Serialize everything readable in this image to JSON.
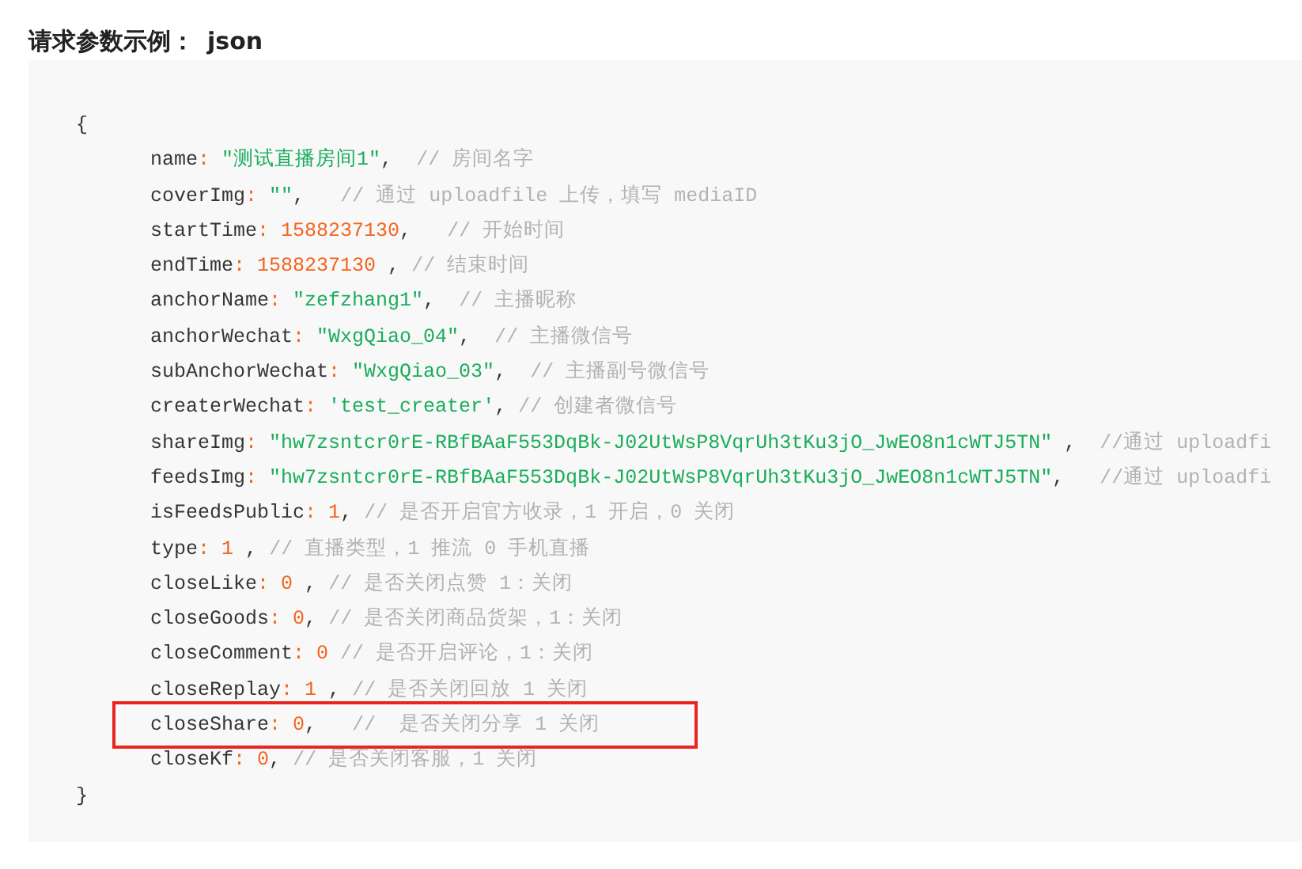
{
  "heading": {
    "label": "请求参数示例：",
    "format": "json"
  },
  "code_block": {
    "lines": [
      {
        "kind": "brace",
        "highlighted": false,
        "tokens": [
          {
            "kind": "plain",
            "text": "{"
          }
        ]
      },
      {
        "kind": "field",
        "highlighted": false,
        "tokens": [
          {
            "kind": "key",
            "text": "name"
          },
          {
            "kind": "colon",
            "text": ": "
          },
          {
            "kind": "string",
            "text": "\"测试直播房间1\""
          },
          {
            "kind": "plain",
            "text": ",  "
          },
          {
            "kind": "comment",
            "text": "// 房间名字"
          }
        ]
      },
      {
        "kind": "field",
        "highlighted": false,
        "tokens": [
          {
            "kind": "key",
            "text": "coverImg"
          },
          {
            "kind": "colon",
            "text": ": "
          },
          {
            "kind": "string",
            "text": "\"\""
          },
          {
            "kind": "plain",
            "text": ",   "
          },
          {
            "kind": "comment",
            "text": "// 通过 uploadfile 上传，填写 mediaID"
          }
        ]
      },
      {
        "kind": "field",
        "highlighted": false,
        "tokens": [
          {
            "kind": "key",
            "text": "startTime"
          },
          {
            "kind": "colon",
            "text": ": "
          },
          {
            "kind": "number",
            "text": "1588237130"
          },
          {
            "kind": "plain",
            "text": ",   "
          },
          {
            "kind": "comment",
            "text": "// 开始时间"
          }
        ]
      },
      {
        "kind": "field",
        "highlighted": false,
        "tokens": [
          {
            "kind": "key",
            "text": "endTime"
          },
          {
            "kind": "colon",
            "text": ": "
          },
          {
            "kind": "number",
            "text": "1588237130"
          },
          {
            "kind": "plain",
            "text": " , "
          },
          {
            "kind": "comment",
            "text": "// 结束时间"
          }
        ]
      },
      {
        "kind": "field",
        "highlighted": false,
        "tokens": [
          {
            "kind": "key",
            "text": "anchorName"
          },
          {
            "kind": "colon",
            "text": ": "
          },
          {
            "kind": "string",
            "text": "\"zefzhang1\""
          },
          {
            "kind": "plain",
            "text": ",  "
          },
          {
            "kind": "comment",
            "text": "// 主播昵称"
          }
        ]
      },
      {
        "kind": "field",
        "highlighted": false,
        "tokens": [
          {
            "kind": "key",
            "text": "anchorWechat"
          },
          {
            "kind": "colon",
            "text": ": "
          },
          {
            "kind": "string",
            "text": "\"WxgQiao_04\""
          },
          {
            "kind": "plain",
            "text": ",  "
          },
          {
            "kind": "comment",
            "text": "// 主播微信号"
          }
        ]
      },
      {
        "kind": "field",
        "highlighted": false,
        "tokens": [
          {
            "kind": "key",
            "text": "subAnchorWechat"
          },
          {
            "kind": "colon",
            "text": ": "
          },
          {
            "kind": "string",
            "text": "\"WxgQiao_03\""
          },
          {
            "kind": "plain",
            "text": ",  "
          },
          {
            "kind": "comment",
            "text": "// 主播副号微信号"
          }
        ]
      },
      {
        "kind": "field",
        "highlighted": false,
        "tokens": [
          {
            "kind": "key",
            "text": "createrWechat"
          },
          {
            "kind": "colon",
            "text": ": "
          },
          {
            "kind": "string",
            "text": "'test_creater'"
          },
          {
            "kind": "plain",
            "text": ", "
          },
          {
            "kind": "comment",
            "text": "// 创建者微信号"
          }
        ]
      },
      {
        "kind": "field",
        "highlighted": false,
        "tokens": [
          {
            "kind": "key",
            "text": "shareImg"
          },
          {
            "kind": "colon",
            "text": ": "
          },
          {
            "kind": "string",
            "text": "\"hw7zsntcr0rE-RBfBAaF553DqBk-J02UtWsP8VqrUh3tKu3jO_JwEO8n1cWTJ5TN\""
          },
          {
            "kind": "plain",
            "text": " ,  "
          },
          {
            "kind": "comment",
            "text": "//通过 uploadfi"
          }
        ]
      },
      {
        "kind": "field",
        "highlighted": false,
        "tokens": [
          {
            "kind": "key",
            "text": "feedsImg"
          },
          {
            "kind": "colon",
            "text": ": "
          },
          {
            "kind": "string",
            "text": "\"hw7zsntcr0rE-RBfBAaF553DqBk-J02UtWsP8VqrUh3tKu3jO_JwEO8n1cWTJ5TN\""
          },
          {
            "kind": "plain",
            "text": ",   "
          },
          {
            "kind": "comment",
            "text": "//通过 uploadfi"
          }
        ]
      },
      {
        "kind": "field",
        "highlighted": false,
        "tokens": [
          {
            "kind": "key",
            "text": "isFeedsPublic"
          },
          {
            "kind": "colon",
            "text": ": "
          },
          {
            "kind": "number",
            "text": "1"
          },
          {
            "kind": "plain",
            "text": ", "
          },
          {
            "kind": "comment",
            "text": "// 是否开启官方收录，1 开启，0 关闭"
          }
        ]
      },
      {
        "kind": "field",
        "highlighted": false,
        "tokens": [
          {
            "kind": "key",
            "text": "type"
          },
          {
            "kind": "colon",
            "text": ": "
          },
          {
            "kind": "number",
            "text": "1"
          },
          {
            "kind": "plain",
            "text": " , "
          },
          {
            "kind": "comment",
            "text": "// 直播类型，1 推流 0 手机直播"
          }
        ]
      },
      {
        "kind": "field",
        "highlighted": false,
        "tokens": [
          {
            "kind": "key",
            "text": "closeLike"
          },
          {
            "kind": "colon",
            "text": ": "
          },
          {
            "kind": "number",
            "text": "0"
          },
          {
            "kind": "plain",
            "text": " , "
          },
          {
            "kind": "comment",
            "text": "// 是否关闭点赞 1：关闭"
          }
        ]
      },
      {
        "kind": "field",
        "highlighted": false,
        "tokens": [
          {
            "kind": "key",
            "text": "closeGoods"
          },
          {
            "kind": "colon",
            "text": ": "
          },
          {
            "kind": "number",
            "text": "0"
          },
          {
            "kind": "plain",
            "text": ", "
          },
          {
            "kind": "comment",
            "text": "// 是否关闭商品货架，1：关闭"
          }
        ]
      },
      {
        "kind": "field",
        "highlighted": false,
        "tokens": [
          {
            "kind": "key",
            "text": "closeComment"
          },
          {
            "kind": "colon",
            "text": ": "
          },
          {
            "kind": "number",
            "text": "0"
          },
          {
            "kind": "comment",
            "text": " // 是否开启评论，1：关闭"
          }
        ]
      },
      {
        "kind": "field",
        "highlighted": false,
        "tokens": [
          {
            "kind": "key",
            "text": "closeReplay"
          },
          {
            "kind": "colon",
            "text": ": "
          },
          {
            "kind": "number",
            "text": "1"
          },
          {
            "kind": "plain",
            "text": " , "
          },
          {
            "kind": "comment",
            "text": "// 是否关闭回放 1 关闭"
          }
        ]
      },
      {
        "kind": "field",
        "highlighted": true,
        "tokens": [
          {
            "kind": "key",
            "text": "closeShare"
          },
          {
            "kind": "colon",
            "text": ": "
          },
          {
            "kind": "number",
            "text": "0"
          },
          {
            "kind": "plain",
            "text": ",   "
          },
          {
            "kind": "comment",
            "text": "//  是否关闭分享 1 关闭"
          }
        ]
      },
      {
        "kind": "field",
        "highlighted": false,
        "tokens": [
          {
            "kind": "key",
            "text": "closeKf"
          },
          {
            "kind": "colon",
            "text": ": "
          },
          {
            "kind": "number",
            "text": "0"
          },
          {
            "kind": "plain",
            "text": ", "
          },
          {
            "kind": "comment",
            "text": "// 是否关闭客服，1 关闭"
          }
        ]
      },
      {
        "kind": "brace",
        "highlighted": false,
        "tokens": [
          {
            "kind": "plain",
            "text": "}"
          }
        ]
      }
    ]
  }
}
